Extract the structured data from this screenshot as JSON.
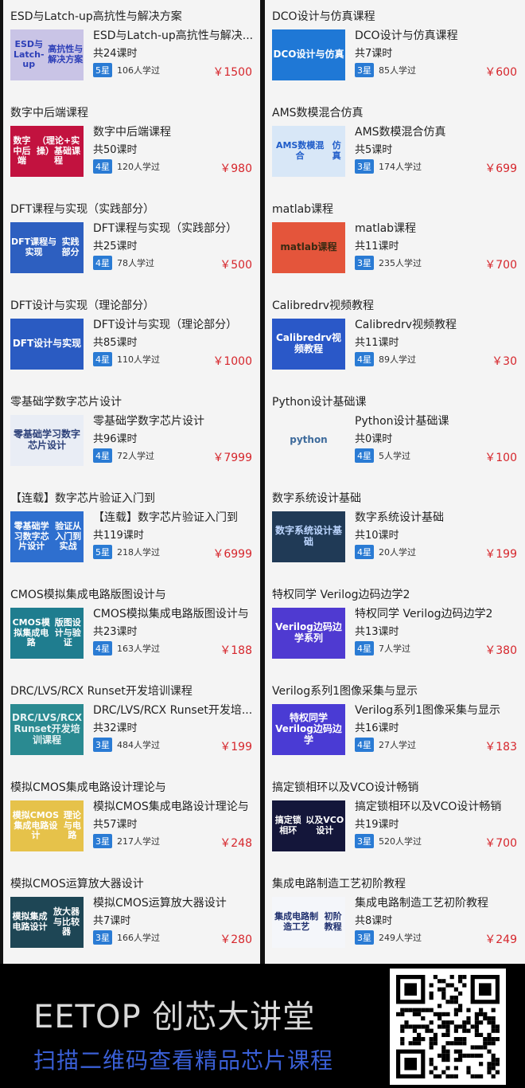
{
  "left_courses": [
    {
      "title": "ESD与Latch-up高抗性与解决方案",
      "name": "ESD与Latch-up高抗性与解决...",
      "lessons": "共24课时",
      "stars": "5星",
      "learners": "106人学过",
      "price": "￥1500",
      "thumb_lines": [
        "ESD与Latch-up",
        "高抗性与解决方案"
      ],
      "thumb_bg": "#c9c4e6",
      "thumb_fg": "#2d3fb8"
    },
    {
      "title": "数字中后端课程",
      "name": "数字中后端课程",
      "lessons": "共50课时",
      "stars": "4星",
      "learners": "120人学过",
      "price": "￥980",
      "thumb_lines": [
        "数字中后端",
        "（理论+实操）基础课程"
      ],
      "thumb_bg": "#c2123f",
      "thumb_fg": "#ffffff"
    },
    {
      "title": "DFT课程与实现（实践部分）",
      "name": "DFT课程与实现（实践部分）",
      "lessons": "共25课时",
      "stars": "4星",
      "learners": "78人学过",
      "price": "￥500",
      "thumb_lines": [
        "DFT课程与实现",
        "实践部分"
      ],
      "thumb_bg": "#2d5fc0",
      "thumb_fg": "#ffffff"
    },
    {
      "title": "DFT设计与实现（理论部分）",
      "name": "DFT设计与实现（理论部分）",
      "lessons": "共85课时",
      "stars": "4星",
      "learners": "110人学过",
      "price": "￥1000",
      "thumb_lines": [
        "DFT设计与实现"
      ],
      "thumb_bg": "#2a5bc2",
      "thumb_fg": "#ffffff"
    },
    {
      "title": "零基础学数字芯片设计",
      "name": "零基础学数字芯片设计",
      "lessons": "共96课时",
      "stars": "4星",
      "learners": "72人学过",
      "price": "￥7999",
      "thumb_lines": [
        "零基础学习数字芯片设计"
      ],
      "thumb_bg": "#e9edf5",
      "thumb_fg": "#2b3f78"
    },
    {
      "title": "【连载】数字芯片验证入门到",
      "name": "【连载】数字芯片验证入门到",
      "lessons": "共119课时",
      "stars": "5星",
      "learners": "218人学过",
      "price": "￥6999",
      "thumb_lines": [
        "零基础学习数字芯片设计",
        "验证从入门到实战"
      ],
      "thumb_bg": "#2e6fcf",
      "thumb_fg": "#ffffff"
    },
    {
      "title": "CMOS模拟集成电路版图设计与",
      "name": "CMOS模拟集成电路版图设计与",
      "lessons": "共23课时",
      "stars": "4星",
      "learners": "163人学过",
      "price": "￥188",
      "thumb_lines": [
        "CMOS模拟集成电路",
        "版图设计与验证"
      ],
      "thumb_bg": "#1f7d8f",
      "thumb_fg": "#ffffff"
    },
    {
      "title": "DRC/LVS/RCX Runset开发培训课程",
      "name": "DRC/LVS/RCX Runset开发培...",
      "lessons": "共32课时",
      "stars": "3星",
      "learners": "484人学过",
      "price": "￥199",
      "thumb_lines": [
        "DRC/LVS/RCX Runset开发培训课程"
      ],
      "thumb_bg": "#2a8a91",
      "thumb_fg": "#e6f3f4"
    },
    {
      "title": "模拟CMOS集成电路设计理论与",
      "name": "模拟CMOS集成电路设计理论与",
      "lessons": "共57课时",
      "stars": "3星",
      "learners": "217人学过",
      "price": "￥248",
      "thumb_lines": [
        "模拟CMOS集成电路设计",
        "理论与电路"
      ],
      "thumb_bg": "#e6c24a",
      "thumb_fg": "#ffffff"
    },
    {
      "title": "模拟CMOS运算放大器设计",
      "name": "模拟CMOS运算放大器设计",
      "lessons": "共7课时",
      "stars": "3星",
      "learners": "166人学过",
      "price": "￥280",
      "thumb_lines": [
        "模拟集成电路设计",
        "放大器与比较器"
      ],
      "thumb_bg": "#1e4655",
      "thumb_fg": "#ffffff"
    }
  ],
  "right_courses": [
    {
      "title": "DCO设计与仿真课程",
      "name": "DCO设计与仿真课程",
      "lessons": "共7课时",
      "stars": "3星",
      "learners": "85人学过",
      "price": "￥600",
      "thumb_lines": [
        "DCO设计与仿真"
      ],
      "thumb_bg": "#1f78d6",
      "thumb_fg": "#ffffff"
    },
    {
      "title": "AMS数模混合仿真",
      "name": "AMS数模混合仿真",
      "lessons": "共5课时",
      "stars": "3星",
      "learners": "174人学过",
      "price": "￥699",
      "thumb_lines": [
        "AMS数模混合",
        "仿真"
      ],
      "thumb_bg": "#d8e7f7",
      "thumb_fg": "#1f5cc9"
    },
    {
      "title": "matlab课程",
      "name": "matlab课程",
      "lessons": "共11课时",
      "stars": "3星",
      "learners": "235人学过",
      "price": "￥700",
      "thumb_lines": [
        "matlab课程"
      ],
      "thumb_bg": "#e4553b",
      "thumb_fg": "#3a2a12"
    },
    {
      "title": "Calibredrv视频教程",
      "name": "Calibredrv视频教程",
      "lessons": "共11课时",
      "stars": "4星",
      "learners": "89人学过",
      "price": "￥30",
      "thumb_lines": [
        "Calibredrv视频教程"
      ],
      "thumb_bg": "#2a58c8",
      "thumb_fg": "#ffffff"
    },
    {
      "title": "Python设计基础课",
      "name": "Python设计基础课",
      "lessons": "共0课时",
      "stars": "4星",
      "learners": "5人学过",
      "price": "￥100",
      "thumb_lines": [
        "python"
      ],
      "thumb_bg": "#f4f4f4",
      "thumb_fg": "#3d6a9b"
    },
    {
      "title": "数字系统设计基础",
      "name": "数字系统设计基础",
      "lessons": "共10课时",
      "stars": "4星",
      "learners": "20人学过",
      "price": "￥199",
      "thumb_lines": [
        "数字系统设计基础"
      ],
      "thumb_bg": "#203a56",
      "thumb_fg": "#bcd6ff"
    },
    {
      "title": "特权同学 Verilog边码边学2",
      "name": "特权同学 Verilog边码边学2",
      "lessons": "共13课时",
      "stars": "4星",
      "learners": "7人学过",
      "price": "￥380",
      "thumb_lines": [
        "Verilog边码边学系列"
      ],
      "thumb_bg": "#4f3ad1",
      "thumb_fg": "#ffffff"
    },
    {
      "title": "Verilog系列1图像采集与显示",
      "name": "Verilog系列1图像采集与显示",
      "lessons": "共16课时",
      "stars": "4星",
      "learners": "27人学过",
      "price": "￥183",
      "thumb_lines": [
        "特权同学 Verilog边码边学"
      ],
      "thumb_bg": "#4a3bd4",
      "thumb_fg": "#ffffff"
    },
    {
      "title": "搞定锁相环以及VCO设计畅销",
      "name": "搞定锁相环以及VCO设计畅销",
      "lessons": "共19课时",
      "stars": "3星",
      "learners": "520人学过",
      "price": "￥700",
      "thumb_lines": [
        "搞定锁相环",
        "以及VCO设计"
      ],
      "thumb_bg": "#14163a",
      "thumb_fg": "#ffffff"
    },
    {
      "title": "集成电路制造工艺初阶教程",
      "name": "集成电路制造工艺初阶教程",
      "lessons": "共8课时",
      "stars": "3星",
      "learners": "249人学过",
      "price": "￥249",
      "thumb_lines": [
        "集成电路制造工艺",
        "初阶教程"
      ],
      "thumb_bg": "#f4f6fa",
      "thumb_fg": "#1e2f6e"
    }
  ],
  "footer": {
    "brand": "EETOP 创芯大讲堂",
    "slogan": "扫描二维码查看精品芯片课程"
  }
}
